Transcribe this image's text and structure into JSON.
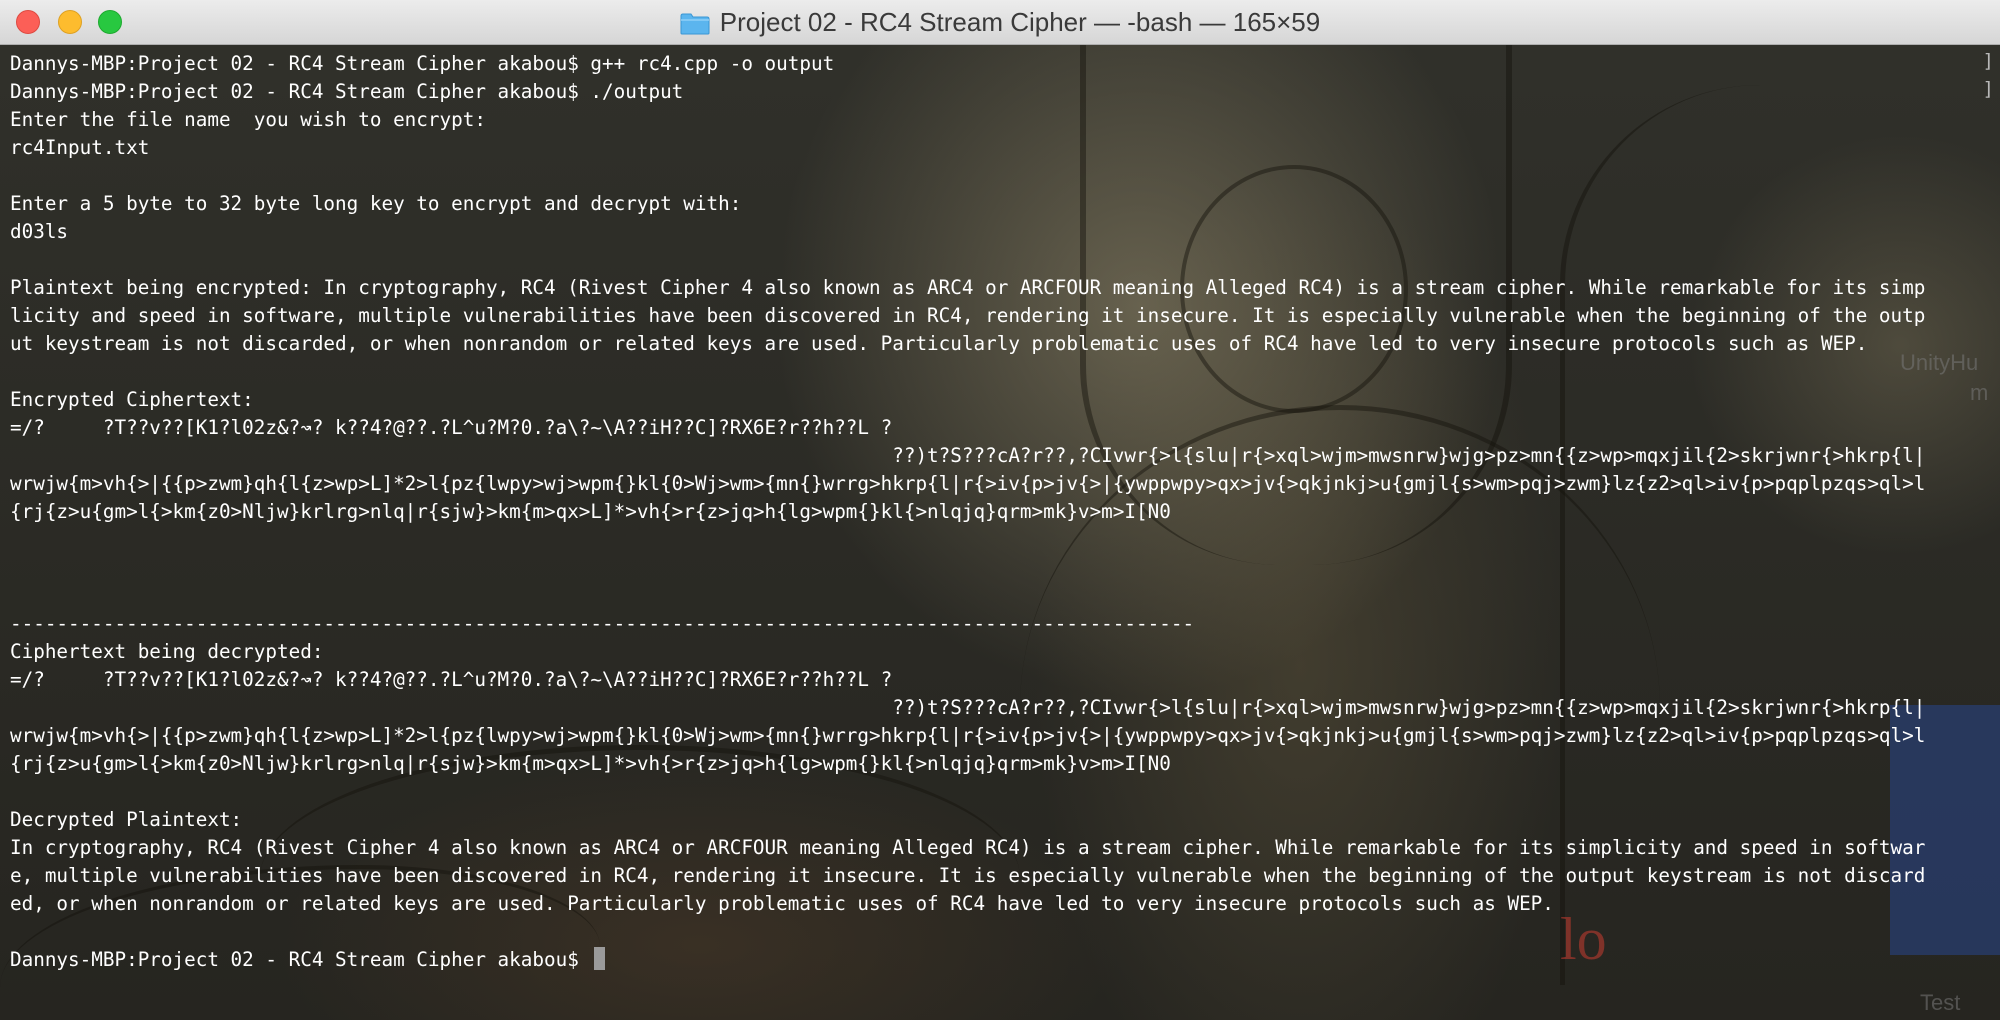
{
  "window": {
    "title": "Project 02 - RC4 Stream Cipher — -bash — 165×59"
  },
  "background": {
    "overlay_labels": [
      "UnityHu",
      "m",
      "lo",
      "Test"
    ]
  },
  "terminal": {
    "lines": [
      "Dannys-MBP:Project 02 - RC4 Stream Cipher akabou$ g++ rc4.cpp -o output",
      "Dannys-MBP:Project 02 - RC4 Stream Cipher akabou$ ./output",
      "Enter the file name  you wish to encrypt:",
      "rc4Input.txt",
      "",
      "Enter a 5 byte to 32 byte long key to encrypt and decrypt with:",
      "d03ls",
      "",
      "Plaintext being encrypted: In cryptography, RC4 (Rivest Cipher 4 also known as ARC4 or ARCFOUR meaning Alleged RC4) is a stream cipher. While remarkable for its simp",
      "licity and speed in software, multiple vulnerabilities have been discovered in RC4, rendering it insecure. It is especially vulnerable when the beginning of the outp",
      "ut keystream is not discarded, or when nonrandom or related keys are used. Particularly problematic uses of RC4 have led to very insecure protocols such as WEP.",
      "",
      "Encrypted Ciphertext:",
      "=/?     ?T??v??[K1?l02z&?↝? k??4?@??.?L^u?M?0.?a\\?~\\A??iH??C]?RX6E?r??h??L ?",
      "                                                                            ??)t?S???cA?r??,?CIvwr{>l{slu|r{>xql>wjm>mwsnrw}wjg>pz>mn{{z>wp>mqxjil{2>skrjwnr{>hkrp{l|",
      "wrwjw{m>vh{>|{{p>zwm}qh{l{z>wp>L]*2>l{pz{lwpy>wj>wpm{}kl{0>Wj>wm>{mn{}wrrg>hkrp{l|r{>iv{p>jv{>|{ywppwpy>qx>jv{>qkjnkj>u{gmjl{s>wm>pqj>zwm}lz{z2>ql>iv{p>pqplpzqs>ql>l",
      "{rj{z>u{gm>l{>km{z0>Nljw}krlrg>nlq|r{sjw}>km{m>qx>L]*>vh{>r{z>jq>h{lg>wpm{}kl{>nlqjq}qrm>mk}v>m>I[N0",
      "",
      "",
      "",
      "------------------------------------------------------------------------------------------------------",
      "Ciphertext being decrypted:",
      "=/?     ?T??v??[K1?l02z&?↝? k??4?@??.?L^u?M?0.?a\\?~\\A??iH??C]?RX6E?r??h??L ?",
      "                                                                            ??)t?S???cA?r??,?CIvwr{>l{slu|r{>xql>wjm>mwsnrw}wjg>pz>mn{{z>wp>mqxjil{2>skrjwnr{>hkrp{l|",
      "wrwjw{m>vh{>|{{p>zwm}qh{l{z>wp>L]*2>l{pz{lwpy>wj>wpm{}kl{0>Wj>wm>{mn{}wrrg>hkrp{l|r{>iv{p>jv{>|{ywppwpy>qx>jv{>qkjnkj>u{gmjl{s>wm>pqj>zwm}lz{z2>ql>iv{p>pqplpzqs>ql>l",
      "{rj{z>u{gm>l{>km{z0>Nljw}krlrg>nlq|r{sjw}>km{m>qx>L]*>vh{>r{z>jq>h{lg>wpm{}kl{>nlqjq}qrm>mk}v>m>I[N0",
      "",
      "Decrypted Plaintext:",
      "In cryptography, RC4 (Rivest Cipher 4 also known as ARC4 or ARCFOUR meaning Alleged RC4) is a stream cipher. While remarkable for its simplicity and speed in softwar",
      "e, multiple vulnerabilities have been discovered in RC4, rendering it insecure. It is especially vulnerable when the beginning of the output keystream is not discard",
      "ed, or when nonrandom or related keys are used. Particularly problematic uses of RC4 have led to very insecure protocols such as WEP.",
      "",
      "Dannys-MBP:Project 02 - RC4 Stream Cipher akabou$ "
    ]
  }
}
